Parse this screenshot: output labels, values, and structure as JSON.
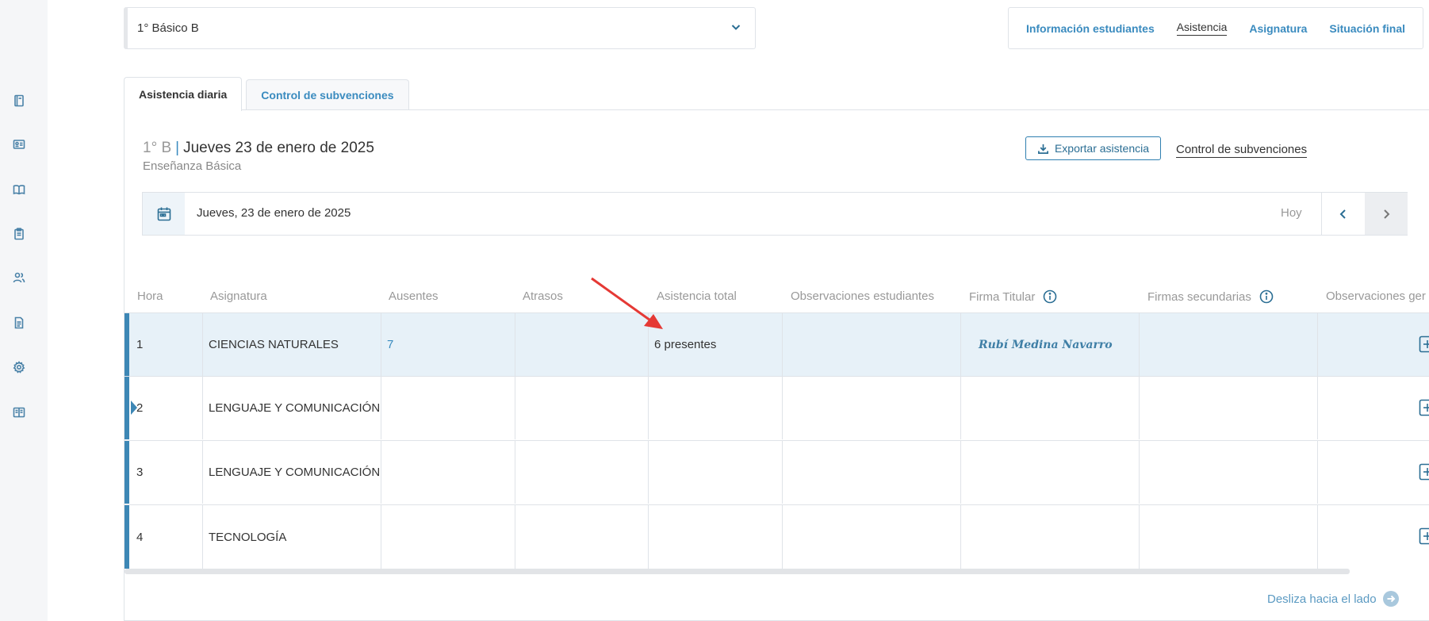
{
  "sidebar": {
    "icons": [
      "notebook-icon",
      "id-card-icon",
      "book-open-icon",
      "clipboard-icon",
      "users-icon",
      "document-icon",
      "gear-icon",
      "manual-icon"
    ]
  },
  "class_select": {
    "value": "1° Básico B"
  },
  "top_nav": {
    "items": [
      "Información estudiantes",
      "Asistencia",
      "Asignatura",
      "Situación final"
    ],
    "active": "Asistencia"
  },
  "tabs": {
    "daily": "Asistencia diaria",
    "subsidies": "Control de subvenciones"
  },
  "header": {
    "grade": "1° B",
    "separator": "|",
    "date": "Jueves 23 de enero de 2025",
    "subtitle": "Enseñanza Básica",
    "export_label": "Exportar asistencia",
    "control_link": "Control de subvenciones"
  },
  "date_bar": {
    "date": "Jueves, 23 de enero de 2025",
    "today": "Hoy"
  },
  "table": {
    "columns": [
      "Hora",
      "Asignatura",
      "Ausentes",
      "Atrasos",
      "Asistencia total",
      "Observaciones estudiantes",
      "Firma Titular",
      "Firmas secundarias",
      "Observaciones ger"
    ],
    "rows": [
      {
        "hora": "1",
        "asignatura": "CIENCIAS NATURALES",
        "ausentes": "7",
        "atrasos": "",
        "asistencia": "6 presentes",
        "observaciones": "",
        "firma": "Rubí Medina Navarro"
      },
      {
        "hora": "2",
        "asignatura": "LENGUAJE Y COMUNICACIÓN",
        "ausentes": "",
        "atrasos": "",
        "asistencia": "",
        "observaciones": "",
        "firma": ""
      },
      {
        "hora": "3",
        "asignatura": "LENGUAJE Y COMUNICACIÓN",
        "ausentes": "",
        "atrasos": "",
        "asistencia": "",
        "observaciones": "",
        "firma": ""
      },
      {
        "hora": "4",
        "asignatura": "TECNOLOGÍA",
        "ausentes": "",
        "atrasos": "",
        "asistencia": "",
        "observaciones": "",
        "firma": ""
      }
    ]
  },
  "footer": {
    "slide_hint": "Desliza hacia el lado"
  },
  "colors": {
    "accent": "#3d87b5",
    "link": "#3a8bbf",
    "highlight_row": "#e7f1f8",
    "annotation_arrow": "#e53935"
  }
}
